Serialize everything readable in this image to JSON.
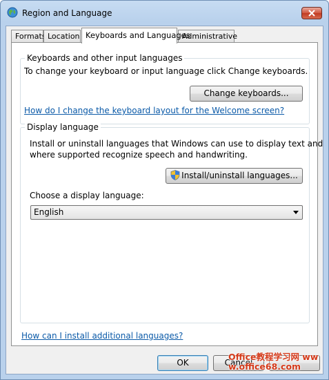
{
  "window": {
    "title": "Region and Language"
  },
  "tabs": [
    {
      "label": "Formats"
    },
    {
      "label": "Location"
    },
    {
      "label": "Keyboards and Languages",
      "active": true
    },
    {
      "label": "Administrative"
    }
  ],
  "keyboards_group": {
    "title": "Keyboards and other input languages",
    "description": "To change your keyboard or input language click Change keyboards.",
    "button_label": "Change keyboards...",
    "link": "How do I change the keyboard layout for the Welcome screen?"
  },
  "display_group": {
    "title": "Display language",
    "description_line1": "Install or uninstall languages that Windows can use to display text and",
    "description_line2": "where supported recognize speech and handwriting.",
    "install_button_label": "Install/uninstall languages...",
    "choose_label": "Choose a display language:",
    "selected_language": "English"
  },
  "bottom_link": "How can I install additional languages?",
  "footer": {
    "ok_label": "OK",
    "cancel_label": "Cancel"
  },
  "watermark": "Office教程学习网 www.office68.com",
  "icons": {
    "app": "globe-icon",
    "close": "close-icon",
    "shield": "uac-shield-icon",
    "dropdown": "chevron-down-icon"
  }
}
